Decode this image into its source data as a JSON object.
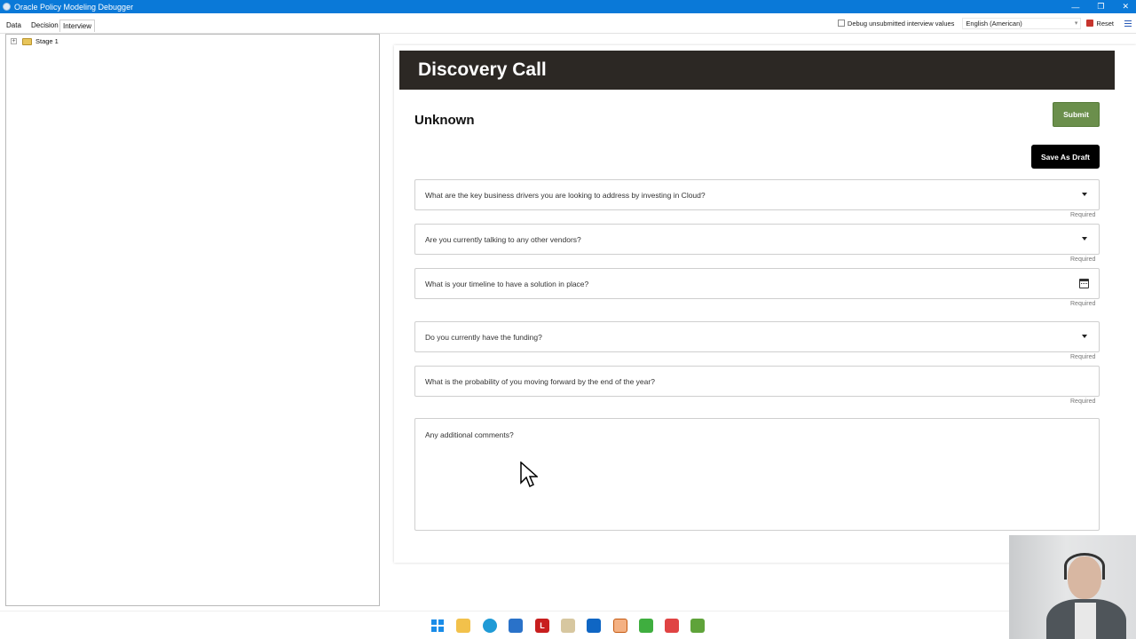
{
  "window": {
    "title": "Oracle Policy Modeling Debugger",
    "controls": [
      "—",
      "❐",
      "✕"
    ]
  },
  "menubar": {
    "tabs": [
      "Data",
      "Decision",
      "Interview"
    ],
    "active_tab": "Interview",
    "debug_checkbox_label": "Debug unsubmitted interview values",
    "debug_checkbox_checked": false,
    "language": "English (American)",
    "reset_label": "Reset"
  },
  "tree": {
    "items": [
      {
        "label": "Stage 1",
        "icon": "folder-icon"
      }
    ]
  },
  "interview": {
    "banner_title": "Discovery Call",
    "section_title": "Unknown",
    "submit_label": "Submit",
    "save_draft_label": "Save As Draft",
    "fields": [
      {
        "label": "What are the key business drivers you are looking to address by investing in Cloud?",
        "type": "dropdown",
        "required": "Required"
      },
      {
        "label": "Are you currently talking to any other vendors?",
        "type": "dropdown",
        "required": "Required"
      },
      {
        "label": "What is your timeline to have a solution in place?",
        "type": "date",
        "required": "Required"
      },
      {
        "label": "Do you currently have the funding?",
        "type": "dropdown",
        "required": "Required"
      },
      {
        "label": "What is the probability of you moving forward by the end of the year?",
        "type": "text",
        "required": "Required"
      }
    ],
    "comments_label": "Any additional comments?"
  },
  "taskbar": {
    "icons": [
      "windows-start-icon",
      "file-explorer-icon",
      "edge-browser-icon",
      "photos-icon",
      "l-app-icon",
      "notepad-icon",
      "outlook-icon",
      "policy-modeling-icon",
      "green-app-icon",
      "red-app-icon",
      "editor-icon"
    ],
    "l_app_letter": "L"
  },
  "colors": {
    "titlebar": "#0a79d8",
    "banner": "#2c2824",
    "submit": "#6b8f4c",
    "save_draft": "#000000"
  }
}
